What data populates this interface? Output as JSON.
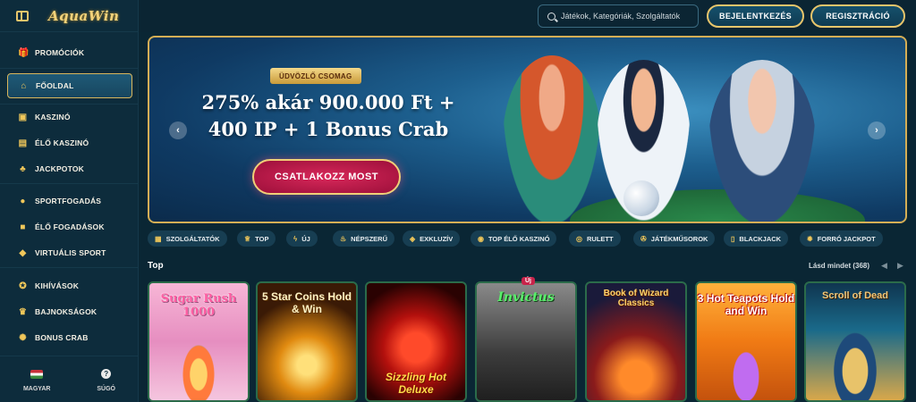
{
  "sidebar": {
    "logo": "AquaWin",
    "items": [
      {
        "label": "PROMÓCIÓK",
        "icon": "gift-icon"
      },
      {
        "label": "FŐOLDAL",
        "icon": "home-icon"
      },
      {
        "label": "KASZINÓ",
        "icon": "slot-machine-icon"
      },
      {
        "label": "ÉLŐ KASZINÓ",
        "icon": "live-card-icon"
      },
      {
        "label": "JACKPOTOK",
        "icon": "clover-icon"
      },
      {
        "label": "SPORTFOGADÁS",
        "icon": "ball-icon"
      },
      {
        "label": "ÉLŐ FOGADÁSOK",
        "icon": "live-bet-icon"
      },
      {
        "label": "VIRTUÁLIS SPORT",
        "icon": "virtual-sport-icon"
      },
      {
        "label": "KIHÍVÁSOK",
        "icon": "medal-icon"
      },
      {
        "label": "BAJNOKSÁGOK",
        "icon": "trophy-icon"
      },
      {
        "label": "BONUS CRAB",
        "icon": "crab-icon"
      }
    ],
    "language": "MAGYAR",
    "help": "SÚGÓ"
  },
  "header": {
    "search_placeholder": "Játékok, Kategóriák, Szolgáltatók",
    "login_label": "BEJELENTKEZÉS",
    "register_label": "REGISZTRÁCIÓ"
  },
  "banner": {
    "badge": "ÜDVÖZLŐ CSOMAG",
    "headline": "275% akár 900.000 Ft + 400 IP + 1 Bonus Crab",
    "cta": "CSATLAKOZZ MOST",
    "prev": "‹",
    "next": "›"
  },
  "tabs": [
    {
      "label": "SZOLGÁLTATÓK",
      "icon": "providers-icon"
    },
    {
      "label": "TOP",
      "icon": "crown-icon"
    },
    {
      "label": "ÚJ",
      "icon": "lightning-icon"
    },
    {
      "label": "NÉPSZERŰ",
      "icon": "flame-icon"
    },
    {
      "label": "EXKLUZÍV",
      "icon": "gem-icon"
    },
    {
      "label": "TOP ÉLŐ KASZINÓ",
      "icon": "chip-icon"
    },
    {
      "label": "RULETT",
      "icon": "roulette-icon"
    },
    {
      "label": "JÁTÉKMŰSOROK",
      "icon": "wheel-icon"
    },
    {
      "label": "BLACKJACK",
      "icon": "cards-icon"
    },
    {
      "label": "FORRÓ JACKPOT",
      "icon": "hot-icon"
    }
  ],
  "section": {
    "title": "Top",
    "see_all": "Lásd mindet (368)"
  },
  "games": [
    {
      "name": "Sugar Rush 1000"
    },
    {
      "name": "5 Star Coins Hold & Win"
    },
    {
      "name": "Sizzling Hot Deluxe"
    },
    {
      "name": "Invictus",
      "badge": "Új"
    },
    {
      "name": "Book of Wizard Classics"
    },
    {
      "name": "3 Hot Teapots Hold and Win"
    },
    {
      "name": "Scroll of Dead"
    }
  ]
}
